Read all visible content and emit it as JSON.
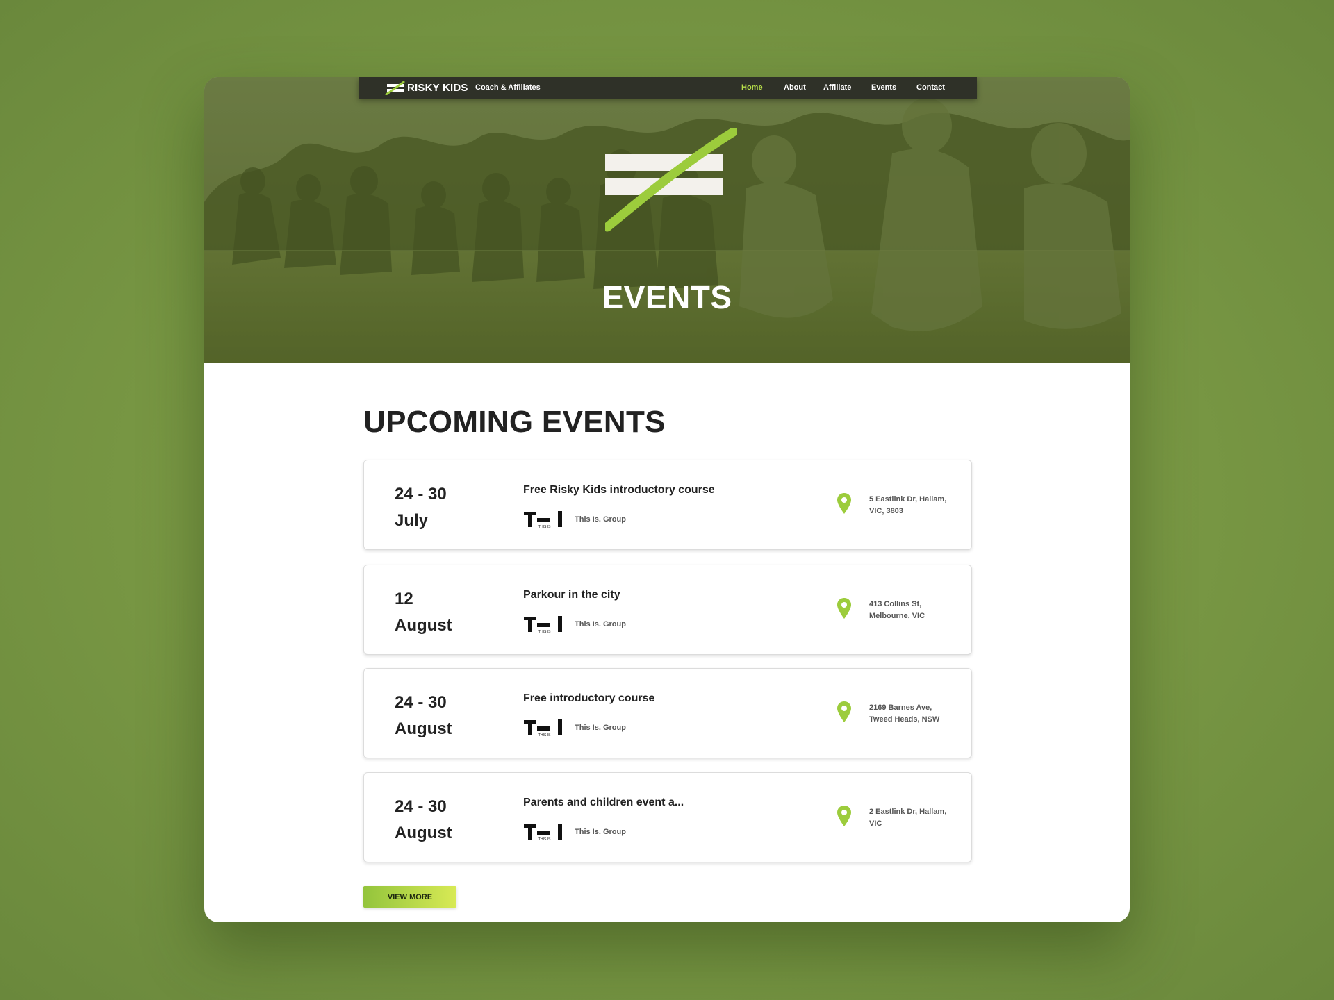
{
  "nav": {
    "brand": "RISKY KIDS",
    "subtitle": "Coach & Affiliates",
    "items": [
      {
        "label": "Home",
        "active": true
      },
      {
        "label": "About",
        "active": false
      },
      {
        "label": "Affiliate",
        "active": false
      },
      {
        "label": "Events",
        "active": false
      },
      {
        "label": "Contact",
        "active": false
      }
    ]
  },
  "hero": {
    "title": "EVENTS"
  },
  "upcoming": {
    "heading": "UPCOMING EVENTS",
    "events": [
      {
        "date_line1": "24 - 30",
        "date_line2": "July",
        "title": "Free Risky Kids introductory course",
        "organizer": "This Is. Group",
        "address_line1": "5 Eastlink Dr, Hallam,",
        "address_line2": "VIC, 3803"
      },
      {
        "date_line1": "12",
        "date_line2": "August",
        "title": "Parkour in the city",
        "organizer": "This Is. Group",
        "address_line1": "413 Collins St,",
        "address_line2": "Melbourne, VIC"
      },
      {
        "date_line1": "24 - 30",
        "date_line2": "August",
        "title": "Free introductory course",
        "organizer": "This Is. Group",
        "address_line1": "2169 Barnes Ave,",
        "address_line2": "Tweed Heads, NSW"
      },
      {
        "date_line1": "24 - 30",
        "date_line2": "August",
        "title": "Parents and children event a...",
        "organizer": "This Is. Group",
        "address_line1": "2 Eastlink Dr, Hallam,",
        "address_line2": "VIC"
      }
    ],
    "view_more": "VIEW MORE"
  },
  "colors": {
    "accent": "#9ccc3c",
    "active_nav": "#b8e04a",
    "navbar_bg": "#2f3128",
    "heading": "#222222"
  },
  "icons": [
    "risky-kids-logo-icon",
    "location-pin-icon",
    "this-is-group-logo-icon"
  ]
}
